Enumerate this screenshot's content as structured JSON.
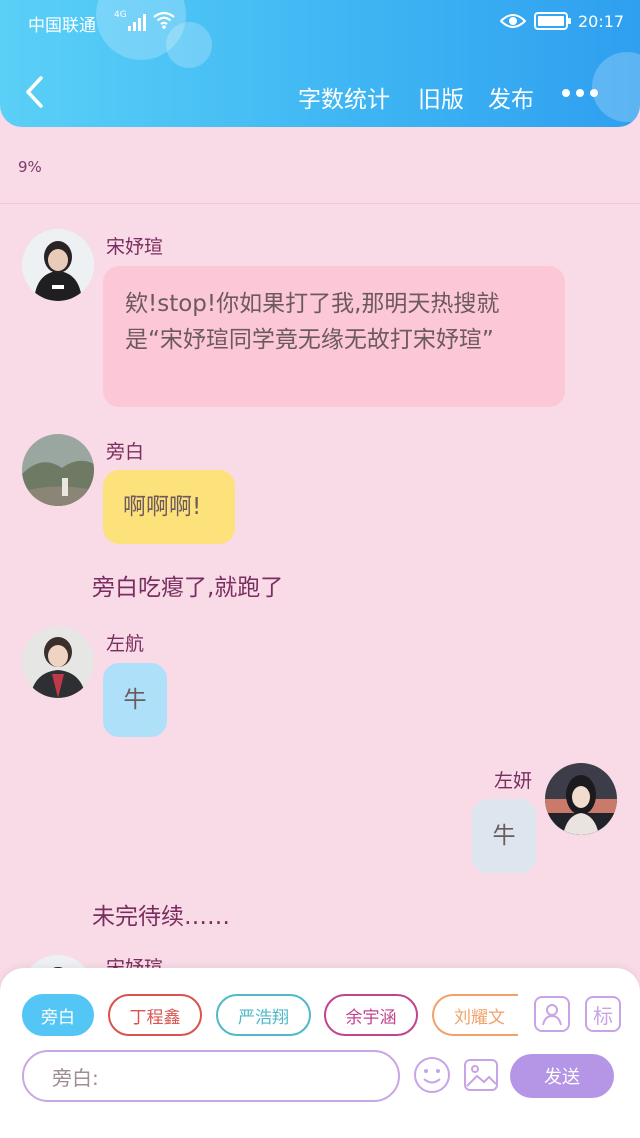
{
  "status_bar": {
    "carrier": "中国联通",
    "network": "4G",
    "time": "20:17"
  },
  "nav": {
    "word_count": "字数统计",
    "old_version": "旧版",
    "publish": "发布"
  },
  "progress": "9%",
  "messages": [
    {
      "speaker": "宋妤瑄",
      "text": "欸!stop!你如果打了我,那明天热搜就是“宋妤瑄同学竟无缘无故打宋妤瑄”"
    },
    {
      "speaker": "旁白",
      "text": "啊啊啊!"
    },
    {
      "narration": "旁白吃瘪了,就跑了"
    },
    {
      "speaker": "左航",
      "text": "牛"
    },
    {
      "speaker": "左妍",
      "text": "牛"
    },
    {
      "narration": "未完待续……"
    },
    {
      "speaker": "宋妤瑄"
    }
  ],
  "characters": [
    "旁白",
    "丁程鑫",
    "严浩翔",
    "余宇涵",
    "刘耀文"
  ],
  "composer": {
    "placeholder": "旁白:",
    "send_label": "发送",
    "tag_icon_label": "标"
  },
  "colors": {
    "header": "#3fb6f3",
    "background": "#f8dbe6",
    "bubble_pink": "#fcc8d8",
    "bubble_yellow": "#fde17a",
    "bubble_blue": "#aee0f9",
    "bubble_gray": "#dde6ee",
    "send": "#b596e6"
  }
}
